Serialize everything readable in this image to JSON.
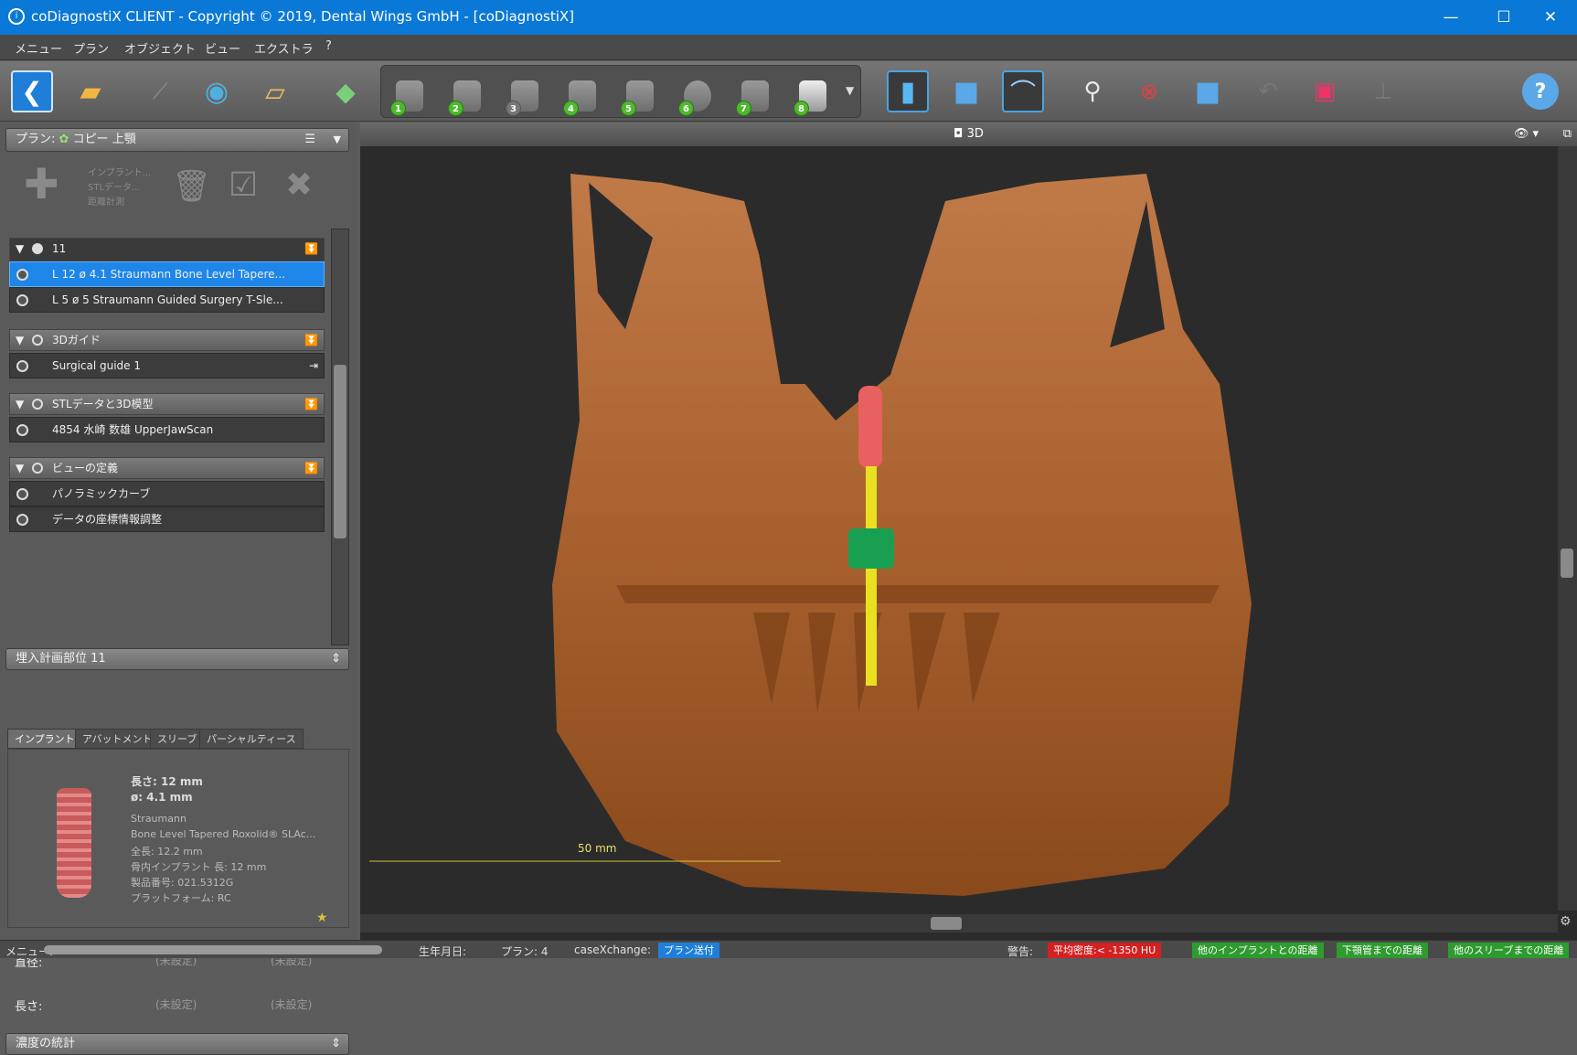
{
  "window": {
    "title": "coDiagnostiX CLIENT - Copyright © 2019, Dental Wings GmbH - [coDiagnostiX]",
    "minimize": "—",
    "maximize": "☐",
    "close": "✕"
  },
  "menu": [
    "メニュー",
    "プラン",
    "オブジェクト",
    "ビュー",
    "エクストラ",
    "?"
  ],
  "toolbar": {
    "steps": [
      "1",
      "2",
      "3",
      "4",
      "5",
      "6",
      "7",
      "8"
    ],
    "help": "?"
  },
  "plan_panel": {
    "label": "プラン:",
    "name": "コピー 上顎",
    "add_menu": [
      "インプラント...",
      "STLデータ...",
      "距離計測"
    ]
  },
  "implant_group": {
    "name": "11",
    "items": [
      {
        "text": "L 12   ø 4.1    Straumann Bone Level Tapere...",
        "active": true
      },
      {
        "text": "L 5   ø 5    Straumann Guided Surgery T-Sle...",
        "active": false
      }
    ]
  },
  "guide_group": {
    "name": "3Dガイド",
    "items": [
      {
        "text": "Surgical guide 1"
      }
    ]
  },
  "stl_group": {
    "name": "STLデータと3D模型",
    "items": [
      {
        "text": "4854 水崎 数雄 UpperJawScan"
      }
    ]
  },
  "view_group": {
    "name": "ビューの定義",
    "items": [
      {
        "text": "パノラミックカーブ"
      },
      {
        "text": "データの座標情報調整"
      }
    ]
  },
  "planning": {
    "header": "埋入計画部位 11",
    "tabs": [
      "インプラント",
      "アバットメント",
      "スリーブ",
      "パーシャルティース"
    ],
    "length": "長さ:  12 mm",
    "diameter": "ø: 4.1 mm",
    "manufacturer": "Straumann",
    "product": "Bone Level Tapered Roxolid® SLAc...",
    "total_length": "全長: 12.2 mm",
    "bone_length": "骨内インプラント 長: 12 mm",
    "article": "製品番号: 021.5312G",
    "platform": "プラットフォーム: RC",
    "diameter_label": "直径:",
    "length_label": "長さ:",
    "unset": "(未設定)"
  },
  "density": {
    "header": "濃度の統計"
  },
  "viewport": {
    "title": "3D",
    "scale_label": "50 mm"
  },
  "status": {
    "menu": "メニュー:",
    "birth": "生年月日:",
    "plan": "プラン: 4",
    "case": "caseXchange:",
    "case_btn": "プラン送付",
    "warn": "警告:",
    "badges": [
      {
        "text": "平均密度:< -1350 HU",
        "color": "#d42020"
      },
      {
        "text": "他のインプラントとの距離",
        "color": "#2e9b2e"
      },
      {
        "text": "下顎管までの距離",
        "color": "#2e9b2e"
      },
      {
        "text": "他のスリーブまでの距離",
        "color": "#2e9b2e"
      }
    ]
  }
}
